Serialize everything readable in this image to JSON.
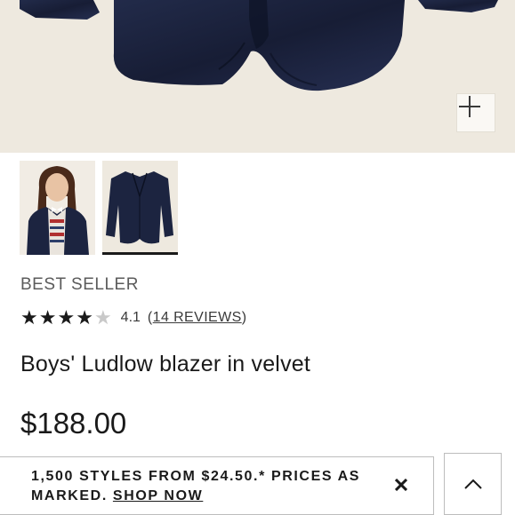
{
  "product": {
    "badge": "BEST SELLER",
    "rating_value": "4.1",
    "rating_stars": 4,
    "rating_max": 5,
    "reviews_open": "(",
    "reviews_label": "14 REVIEWS",
    "reviews_close": ")",
    "title": "Boys' Ludlow blazer in velvet",
    "price": "$188.00"
  },
  "gallery": {
    "zoom_icon": "plus-icon",
    "thumbnails": [
      {
        "name": "model-photo"
      },
      {
        "name": "blazer-photo",
        "selected": true
      }
    ]
  },
  "promo": {
    "text": "1,500 STYLES FROM $24.50.* PRICES AS MARKED.",
    "link": "SHOP NOW",
    "close_icon": "close-icon"
  },
  "scroll_top": {
    "icon": "chevron-up-icon"
  },
  "colors": {
    "navy_velvet": "#1c2440",
    "hero_bg": "#eee9df",
    "text": "#1a1a1a"
  }
}
